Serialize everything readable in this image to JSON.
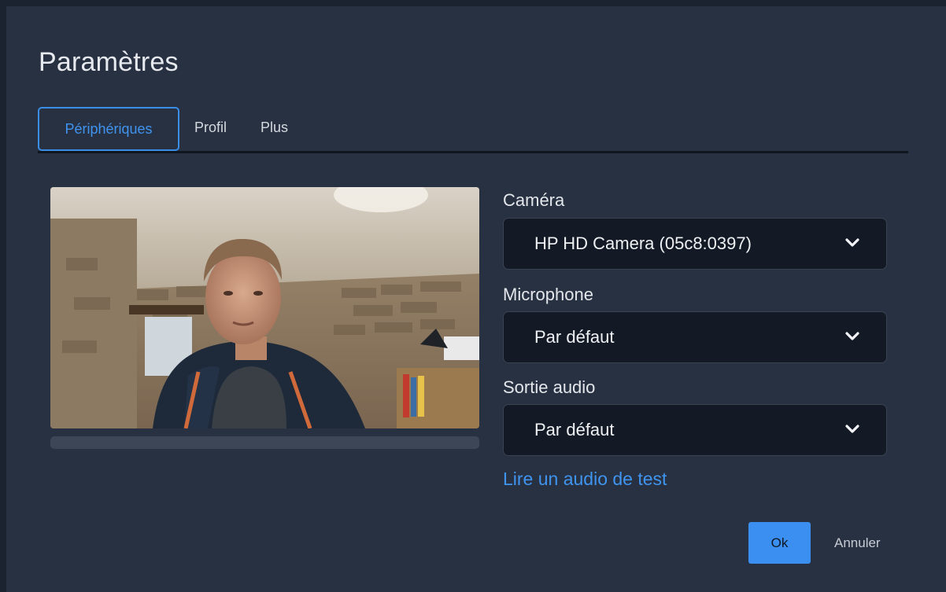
{
  "dialog": {
    "title": "Paramètres"
  },
  "tabs": [
    {
      "label": "Périphériques",
      "active": true
    },
    {
      "label": "Profil",
      "active": false
    },
    {
      "label": "Plus",
      "active": false
    }
  ],
  "camera": {
    "label": "Caméra",
    "value": "HP HD Camera (05c8:0397)"
  },
  "microphone": {
    "label": "Microphone",
    "value": "Par défaut"
  },
  "audio_output": {
    "label": "Sortie audio",
    "value": "Par défaut"
  },
  "test_audio_link": "Lire un audio de test",
  "buttons": {
    "ok": "Ok",
    "cancel": "Annuler"
  },
  "colors": {
    "accent": "#3b8ff0",
    "background": "#283142",
    "select_background": "#131a25"
  },
  "icons": {
    "dropdown": "chevron-down-icon"
  }
}
